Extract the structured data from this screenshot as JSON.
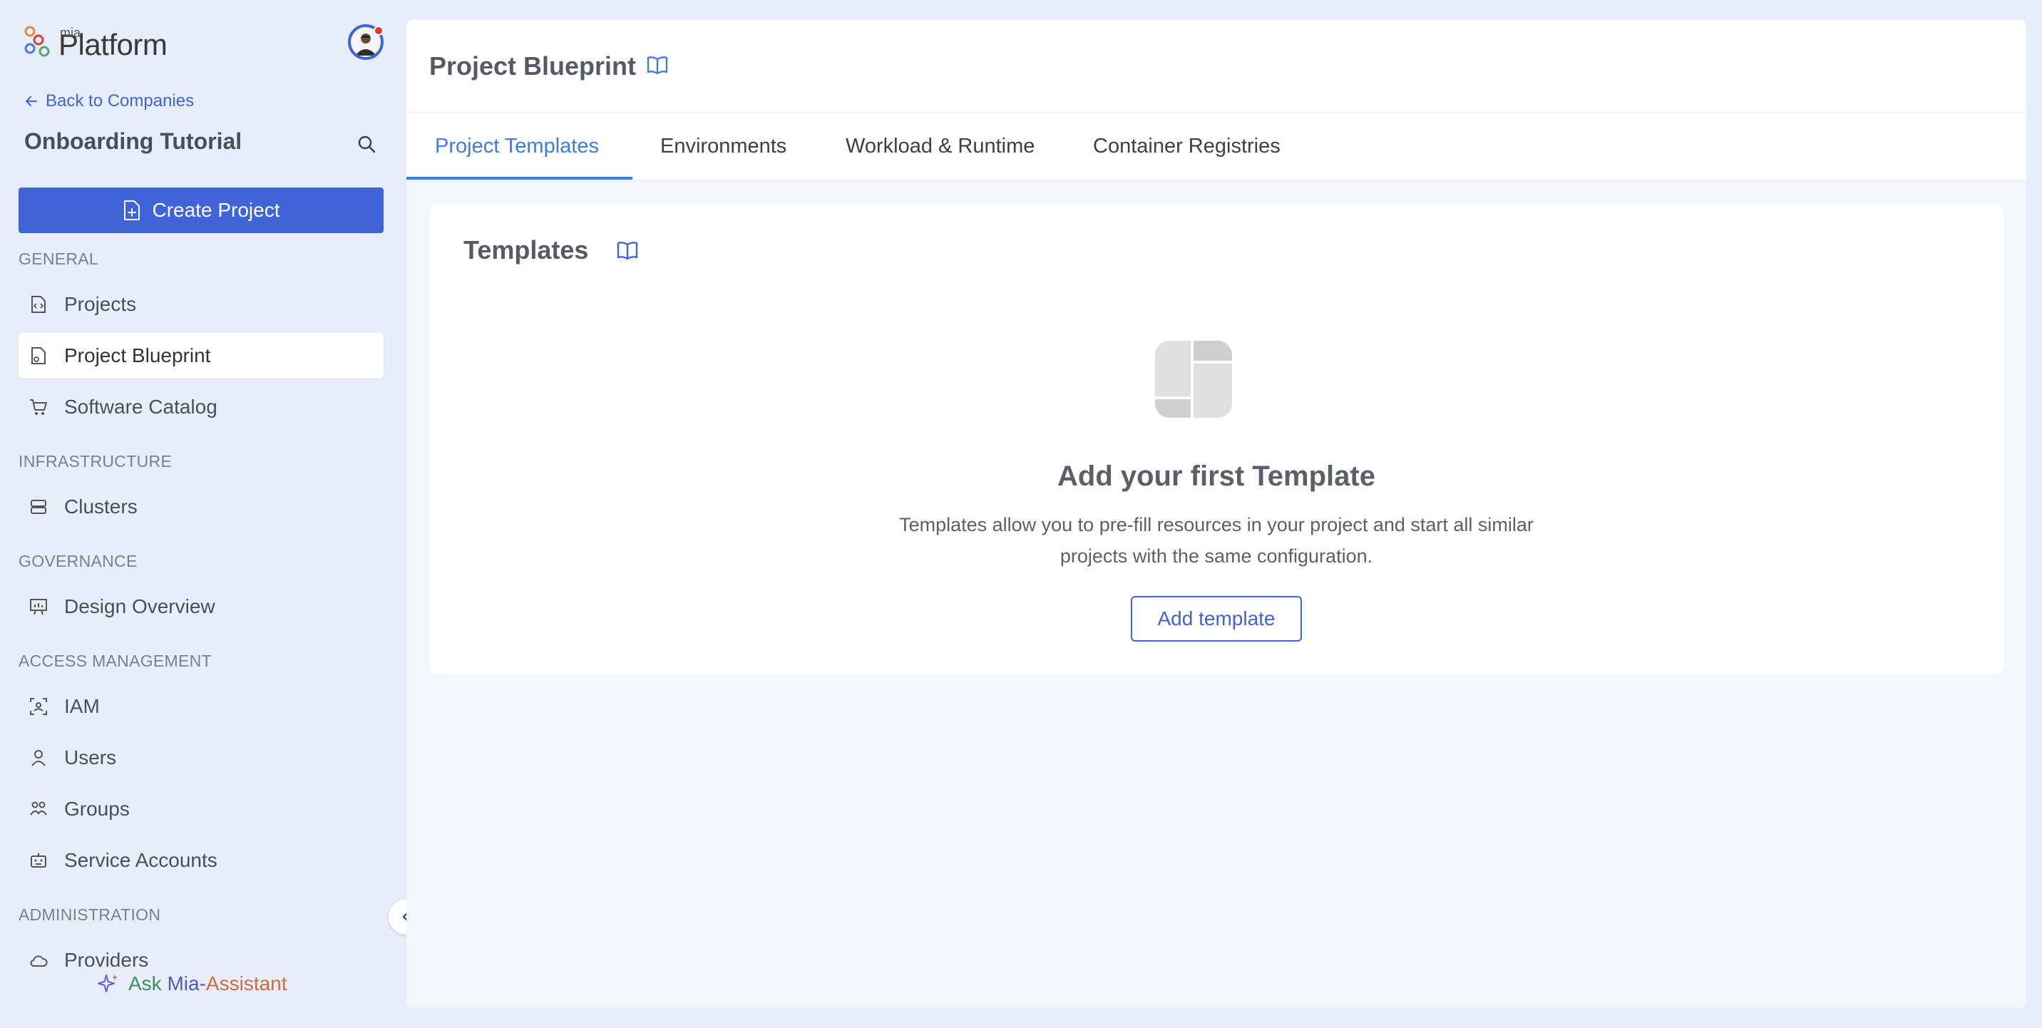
{
  "logo": {
    "small": "mia",
    "big": "Platform"
  },
  "sidebar": {
    "back_label": "Back to Companies",
    "company": "Onboarding Tutorial",
    "create_label": "Create Project",
    "sections": {
      "general": "GENERAL",
      "infrastructure": "INFRASTRUCTURE",
      "governance": "GOVERNANCE",
      "access": "ACCESS MANAGEMENT",
      "administration": "ADMINISTRATION"
    },
    "items": {
      "projects": "Projects",
      "blueprint": "Project Blueprint",
      "catalog": "Software Catalog",
      "clusters": "Clusters",
      "design": "Design Overview",
      "iam": "IAM",
      "users": "Users",
      "groups": "Groups",
      "service_accounts": "Service Accounts",
      "providers": "Providers"
    },
    "assistant": {
      "ask": "Ask",
      "mia": "Mia-",
      "assistant": "Assistant"
    }
  },
  "header": {
    "title": "Project Blueprint"
  },
  "tabs": [
    {
      "label": "Project Templates"
    },
    {
      "label": "Environments"
    },
    {
      "label": "Workload & Runtime"
    },
    {
      "label": "Container Registries"
    }
  ],
  "templates": {
    "title": "Templates",
    "empty_title": "Add your first Template",
    "empty_desc": "Templates allow you to pre-fill resources in your project and start all similar projects with the same configuration.",
    "add_label": "Add template"
  },
  "colors": {
    "primary": "#3f64d8",
    "tab_active": "#3f7be0"
  }
}
